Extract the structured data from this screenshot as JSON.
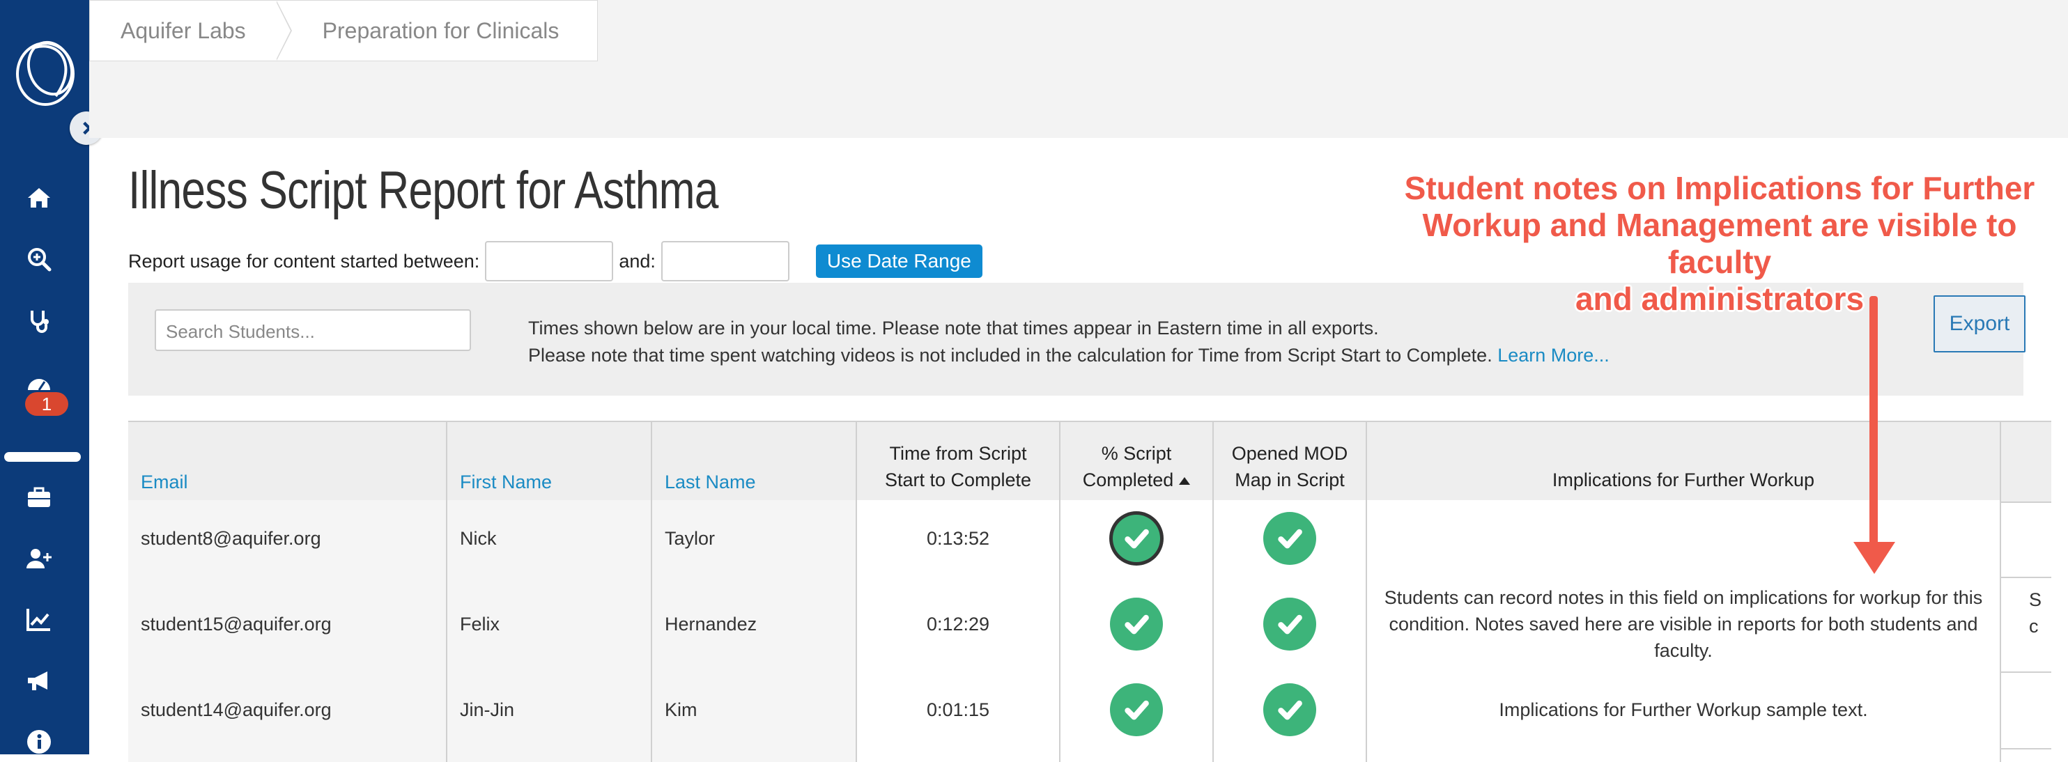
{
  "breadcrumb": [
    "Aquifer Labs",
    "Preparation for Clinicals"
  ],
  "page_title": "Illness Script Report for Asthma",
  "date_filter": {
    "label_start": "Report usage for content started between:",
    "label_and": "and:",
    "button": "Use Date Range"
  },
  "sidebar": {
    "items": [
      {
        "icon": "home-icon"
      },
      {
        "icon": "search-zoom-icon"
      },
      {
        "icon": "stethoscope-icon"
      },
      {
        "icon": "dashboard-icon",
        "badge": "1"
      },
      {
        "icon": "briefcase-icon"
      },
      {
        "icon": "add-user-icon"
      },
      {
        "icon": "chart-line-icon"
      },
      {
        "icon": "megaphone-icon"
      },
      {
        "icon": "info-icon"
      }
    ]
  },
  "panel": {
    "search_placeholder": "Search Students...",
    "note_line1": "Times shown below are in your local time. Please note that times appear in Eastern time in all exports.",
    "note_line2": "Please note that time spent watching videos is not included in the calculation for Time from Script Start to Complete.",
    "learn_more": "Learn More...",
    "export": "Export"
  },
  "table": {
    "headers": {
      "email": "Email",
      "first_name": "First Name",
      "last_name": "Last Name",
      "time_l1": "Time from Script",
      "time_l2": "Start to Complete",
      "pct_l1": "% Script",
      "pct_l2": "Completed",
      "mod_l1": "Opened MOD",
      "mod_l2": "Map in Script",
      "implications": "Implications for Further Workup"
    },
    "rows": [
      {
        "email": "student8@aquifer.org",
        "first": "Nick",
        "last": "Taylor",
        "time": "0:13:52",
        "completed": true,
        "opened_mod": true,
        "implications": ""
      },
      {
        "email": "student15@aquifer.org",
        "first": "Felix",
        "last": "Hernandez",
        "time": "0:12:29",
        "completed": true,
        "opened_mod": true,
        "implications": "Students can record notes in this field on implications for workup for this condition. Notes saved here are visible in reports for both students and faculty."
      },
      {
        "email": "student14@aquifer.org",
        "first": "Jin-Jin",
        "last": "Kim",
        "time": "0:01:15",
        "completed": true,
        "opened_mod": true,
        "implications": "Implications for Further Workup sample text."
      }
    ],
    "overflow_fragments": [
      "S",
      "c"
    ]
  },
  "annotation": {
    "line1": "Student notes on Implications for Further",
    "line2": "Workup and Management are visible to faculty",
    "line3": "and administrators"
  },
  "colors": {
    "sidebar": "#0c3b7a",
    "accent_blue": "#0f8bd1",
    "check_green": "#3db47a",
    "annotation_red": "#f05a4a",
    "badge_red": "#d9472f"
  }
}
